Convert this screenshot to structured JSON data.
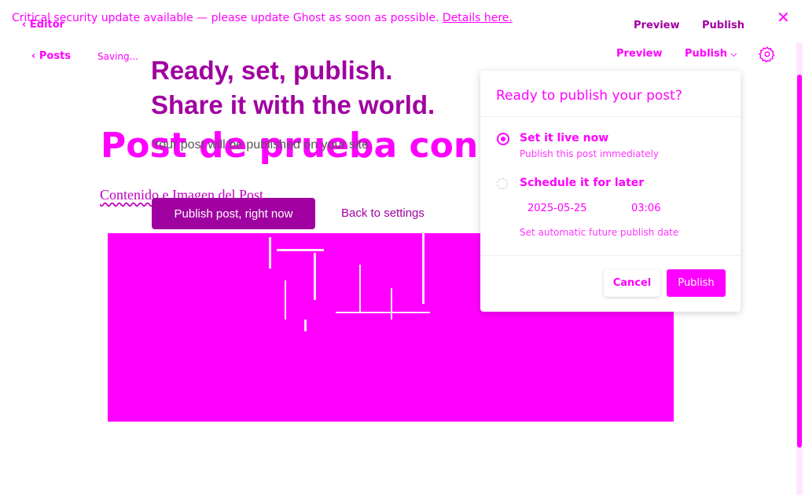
{
  "banner": {
    "message": "Critical security update available — please update Ghost as soon as possible.",
    "link": "Details here."
  },
  "top_bar": {
    "editor_label": "Editor",
    "preview_label": "Preview",
    "publish_label": "Publish"
  },
  "editor_bar": {
    "posts_label": "Posts",
    "status": "Saving...",
    "preview_label": "Preview",
    "publish_label": "Publish"
  },
  "publish_flow": {
    "headline_line1": "Ready, set, publish.",
    "headline_line2": "Share it with the world.",
    "subtext": "Your post will be published on your site.",
    "publish_now_button": "Publish post, right now",
    "back_link": "Back to settings"
  },
  "post": {
    "title": "Post de prueba con Imagen",
    "body": "Contenido e Imagen del Post"
  },
  "popover": {
    "title": "Ready to publish your post?",
    "options": [
      {
        "title": "Set it live now",
        "description": "Publish this post immediately",
        "selected": true
      },
      {
        "title": "Schedule it for later",
        "description": "Set automatic future publish date",
        "selected": false
      }
    ],
    "date_value": "2025-05-25",
    "time_value": "03:06",
    "cancel_label": "Cancel",
    "publish_label": "Publish"
  },
  "colors": {
    "accent": "#ff00ff",
    "accent_dark": "#a000a0"
  }
}
